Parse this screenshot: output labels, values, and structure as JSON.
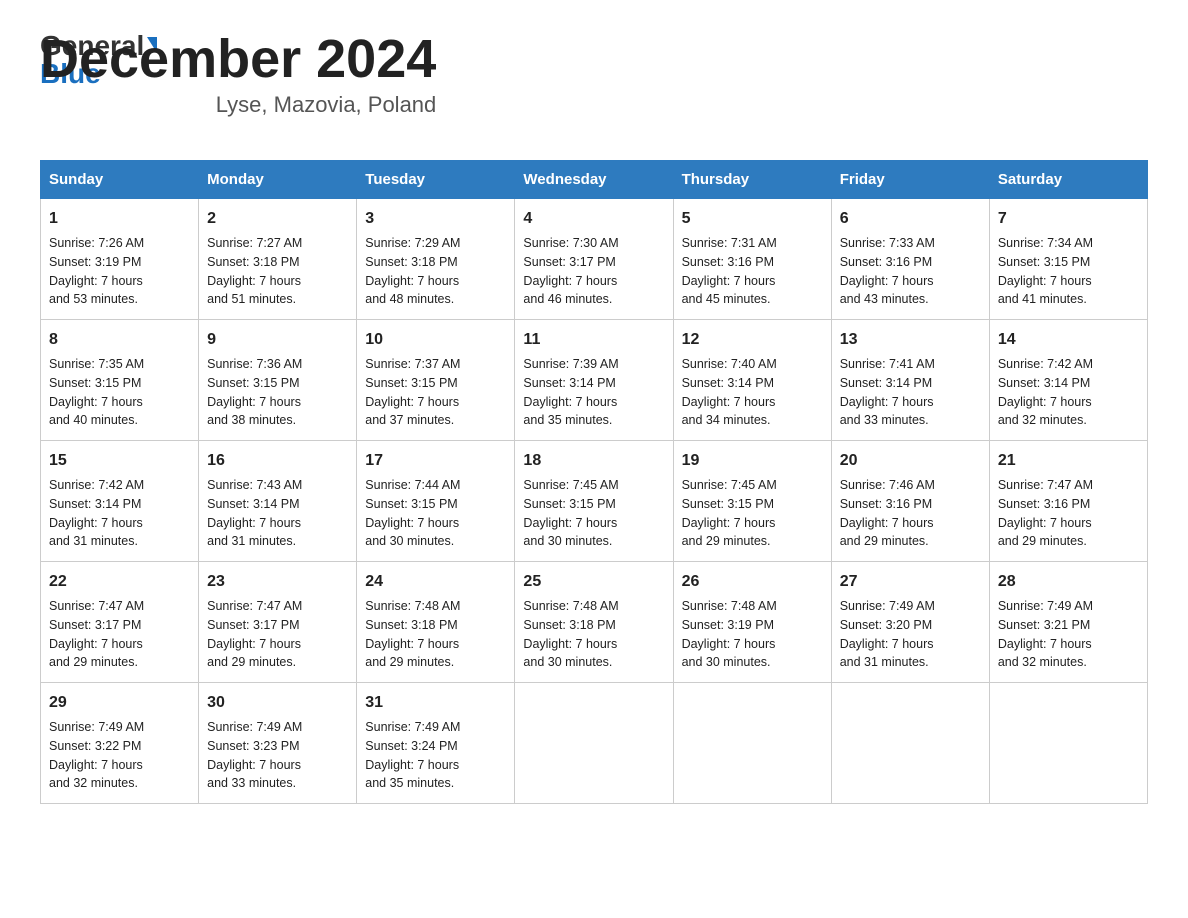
{
  "header": {
    "month_year": "December 2024",
    "location": "Lyse, Mazovia, Poland"
  },
  "days_of_week": [
    "Sunday",
    "Monday",
    "Tuesday",
    "Wednesday",
    "Thursday",
    "Friday",
    "Saturday"
  ],
  "weeks": [
    [
      {
        "day": "1",
        "sunrise": "7:26 AM",
        "sunset": "3:19 PM",
        "daylight": "7 hours and 53 minutes."
      },
      {
        "day": "2",
        "sunrise": "7:27 AM",
        "sunset": "3:18 PM",
        "daylight": "7 hours and 51 minutes."
      },
      {
        "day": "3",
        "sunrise": "7:29 AM",
        "sunset": "3:18 PM",
        "daylight": "7 hours and 48 minutes."
      },
      {
        "day": "4",
        "sunrise": "7:30 AM",
        "sunset": "3:17 PM",
        "daylight": "7 hours and 46 minutes."
      },
      {
        "day": "5",
        "sunrise": "7:31 AM",
        "sunset": "3:16 PM",
        "daylight": "7 hours and 45 minutes."
      },
      {
        "day": "6",
        "sunrise": "7:33 AM",
        "sunset": "3:16 PM",
        "daylight": "7 hours and 43 minutes."
      },
      {
        "day": "7",
        "sunrise": "7:34 AM",
        "sunset": "3:15 PM",
        "daylight": "7 hours and 41 minutes."
      }
    ],
    [
      {
        "day": "8",
        "sunrise": "7:35 AM",
        "sunset": "3:15 PM",
        "daylight": "7 hours and 40 minutes."
      },
      {
        "day": "9",
        "sunrise": "7:36 AM",
        "sunset": "3:15 PM",
        "daylight": "7 hours and 38 minutes."
      },
      {
        "day": "10",
        "sunrise": "7:37 AM",
        "sunset": "3:15 PM",
        "daylight": "7 hours and 37 minutes."
      },
      {
        "day": "11",
        "sunrise": "7:39 AM",
        "sunset": "3:14 PM",
        "daylight": "7 hours and 35 minutes."
      },
      {
        "day": "12",
        "sunrise": "7:40 AM",
        "sunset": "3:14 PM",
        "daylight": "7 hours and 34 minutes."
      },
      {
        "day": "13",
        "sunrise": "7:41 AM",
        "sunset": "3:14 PM",
        "daylight": "7 hours and 33 minutes."
      },
      {
        "day": "14",
        "sunrise": "7:42 AM",
        "sunset": "3:14 PM",
        "daylight": "7 hours and 32 minutes."
      }
    ],
    [
      {
        "day": "15",
        "sunrise": "7:42 AM",
        "sunset": "3:14 PM",
        "daylight": "7 hours and 31 minutes."
      },
      {
        "day": "16",
        "sunrise": "7:43 AM",
        "sunset": "3:14 PM",
        "daylight": "7 hours and 31 minutes."
      },
      {
        "day": "17",
        "sunrise": "7:44 AM",
        "sunset": "3:15 PM",
        "daylight": "7 hours and 30 minutes."
      },
      {
        "day": "18",
        "sunrise": "7:45 AM",
        "sunset": "3:15 PM",
        "daylight": "7 hours and 30 minutes."
      },
      {
        "day": "19",
        "sunrise": "7:45 AM",
        "sunset": "3:15 PM",
        "daylight": "7 hours and 29 minutes."
      },
      {
        "day": "20",
        "sunrise": "7:46 AM",
        "sunset": "3:16 PM",
        "daylight": "7 hours and 29 minutes."
      },
      {
        "day": "21",
        "sunrise": "7:47 AM",
        "sunset": "3:16 PM",
        "daylight": "7 hours and 29 minutes."
      }
    ],
    [
      {
        "day": "22",
        "sunrise": "7:47 AM",
        "sunset": "3:17 PM",
        "daylight": "7 hours and 29 minutes."
      },
      {
        "day": "23",
        "sunrise": "7:47 AM",
        "sunset": "3:17 PM",
        "daylight": "7 hours and 29 minutes."
      },
      {
        "day": "24",
        "sunrise": "7:48 AM",
        "sunset": "3:18 PM",
        "daylight": "7 hours and 29 minutes."
      },
      {
        "day": "25",
        "sunrise": "7:48 AM",
        "sunset": "3:18 PM",
        "daylight": "7 hours and 30 minutes."
      },
      {
        "day": "26",
        "sunrise": "7:48 AM",
        "sunset": "3:19 PM",
        "daylight": "7 hours and 30 minutes."
      },
      {
        "day": "27",
        "sunrise": "7:49 AM",
        "sunset": "3:20 PM",
        "daylight": "7 hours and 31 minutes."
      },
      {
        "day": "28",
        "sunrise": "7:49 AM",
        "sunset": "3:21 PM",
        "daylight": "7 hours and 32 minutes."
      }
    ],
    [
      {
        "day": "29",
        "sunrise": "7:49 AM",
        "sunset": "3:22 PM",
        "daylight": "7 hours and 32 minutes."
      },
      {
        "day": "30",
        "sunrise": "7:49 AM",
        "sunset": "3:23 PM",
        "daylight": "7 hours and 33 minutes."
      },
      {
        "day": "31",
        "sunrise": "7:49 AM",
        "sunset": "3:24 PM",
        "daylight": "7 hours and 35 minutes."
      },
      null,
      null,
      null,
      null
    ]
  ],
  "labels": {
    "sunrise": "Sunrise:",
    "sunset": "Sunset:",
    "daylight": "Daylight:"
  }
}
